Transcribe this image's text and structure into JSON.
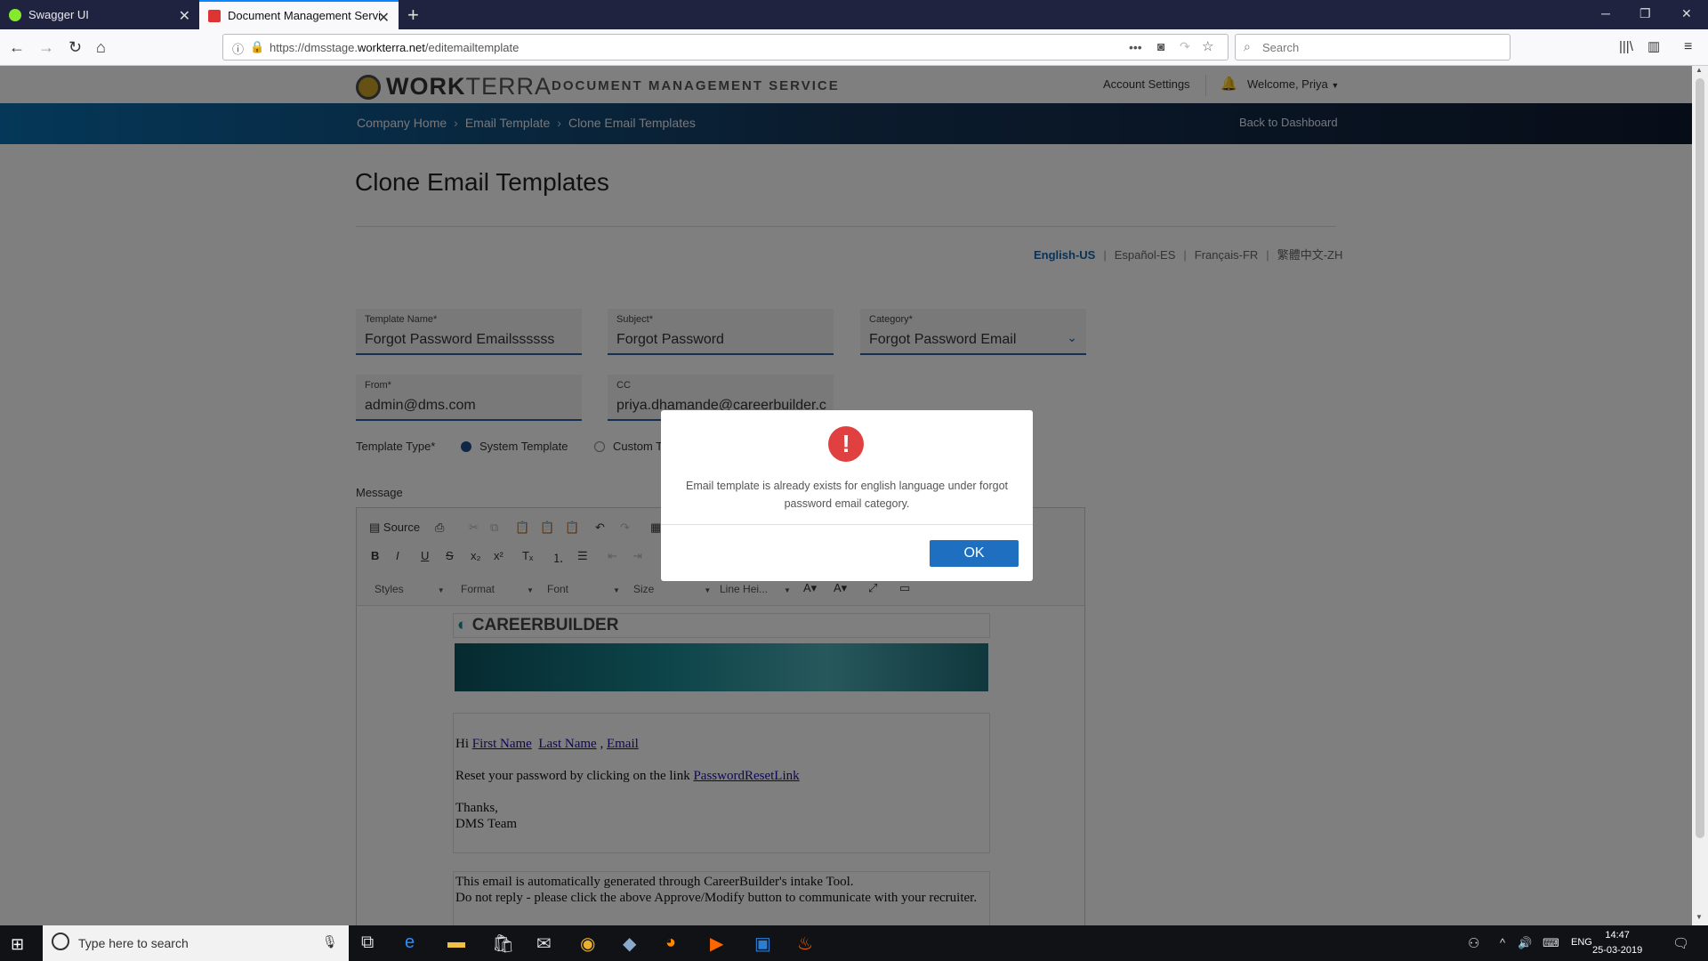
{
  "browser": {
    "tabs": [
      {
        "title": "Swagger UI"
      },
      {
        "title": "Document Management Servic"
      }
    ],
    "url_prefix": "https://dmsstage.",
    "url_domain": "workterra.net",
    "url_path": "/editemailtemplate",
    "search_placeholder": "Search"
  },
  "header": {
    "logo_bold": "WORK",
    "logo_light": "TERRA",
    "service_name": "DOCUMENT MANAGEMENT SERVICE",
    "account_settings": "Account Settings",
    "welcome": "Welcome, Priya"
  },
  "breadcrumb": {
    "items": [
      "Company Home",
      "Email Template",
      "Clone Email Templates"
    ],
    "back_link": "Back to Dashboard"
  },
  "page_title": "Clone Email Templates",
  "languages": [
    "English-US",
    "Español-ES",
    "Français-FR",
    "繁體中文-ZH"
  ],
  "form": {
    "template_name": {
      "label": "Template Name*",
      "value": "Forgot Password Emailssssss"
    },
    "subject": {
      "label": "Subject*",
      "value": "Forgot Password"
    },
    "category": {
      "label": "Category*",
      "value": "Forgot Password Email"
    },
    "from": {
      "label": "From*",
      "value": "admin@dms.com"
    },
    "cc": {
      "label": "CC",
      "value": "priya.dhamande@careerbuilder.c"
    },
    "template_type_label": "Template Type*",
    "template_type_options": [
      "System Template",
      "Custom T"
    ],
    "message_label": "Message"
  },
  "editor": {
    "source_label": "Source",
    "dropdowns": [
      "Styles",
      "Format",
      "Font",
      "Size",
      "Line Hei..."
    ],
    "logo_text": "CAREERBUILDER",
    "greeting": "Hi",
    "links": [
      "First Name",
      "Last Name",
      "Email"
    ],
    "reset_text": "Reset your password by clicking on the link",
    "reset_link": "PasswordResetLink",
    "thanks": "Thanks,",
    "team": "DMS Team",
    "footer_line1": "This email is automatically generated through CareerBuilder's intake Tool.",
    "footer_line2": "Do not reply - please click the above Approve/Modify button to communicate with your recruiter."
  },
  "modal": {
    "message": "Email template is already exists for english language under forgot password email category.",
    "ok_label": "OK"
  },
  "taskbar": {
    "search_placeholder": "Type here to search",
    "lang": "ENG",
    "time": "14:47",
    "date": "25-03-2019"
  }
}
